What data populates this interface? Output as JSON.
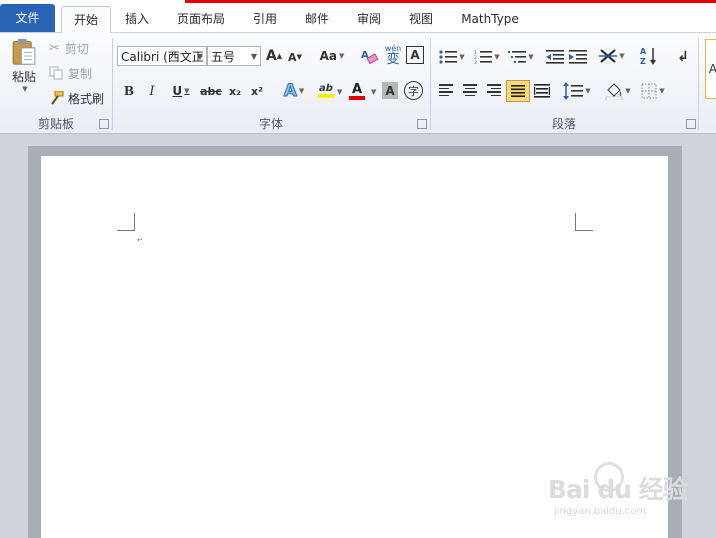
{
  "tabs": {
    "file": "文件",
    "home": "开始",
    "insert": "插入",
    "layout": "页面布局",
    "references": "引用",
    "mailings": "邮件",
    "review": "审阅",
    "view": "视图",
    "mathtype": "MathType"
  },
  "clipboard": {
    "paste": "粘贴",
    "cut": "剪切",
    "copy": "复制",
    "format_painter": "格式刷",
    "group_label": "剪贴板"
  },
  "font": {
    "font_name": "Calibri (西文正",
    "font_size": "五号",
    "grow": "A",
    "shrink": "A",
    "change_case": "Aa",
    "clear": "A",
    "phonetic_top": "wén",
    "phonetic_char": "变",
    "char_border": "A",
    "bold": "B",
    "italic": "I",
    "underline": "U",
    "strike": "abc",
    "subscript": "x₂",
    "superscript": "x²",
    "text_effects": "A",
    "highlight": "ab",
    "font_color": "A",
    "char_shading": "A",
    "enclose_char": "字",
    "group_label": "字体"
  },
  "paragraph": {
    "group_label": "段落"
  },
  "styles": {
    "preview": "A"
  },
  "watermark": {
    "main": "Bai du 经验",
    "sub": "jingyan.baidu.com"
  },
  "document": {
    "para_mark": "↵"
  },
  "colors": {
    "file_tab": "#2b63b5",
    "red_strip": "#e00000",
    "highlight": "#fff200",
    "font_red": "#e00000",
    "active_align": "#fcd87a"
  }
}
